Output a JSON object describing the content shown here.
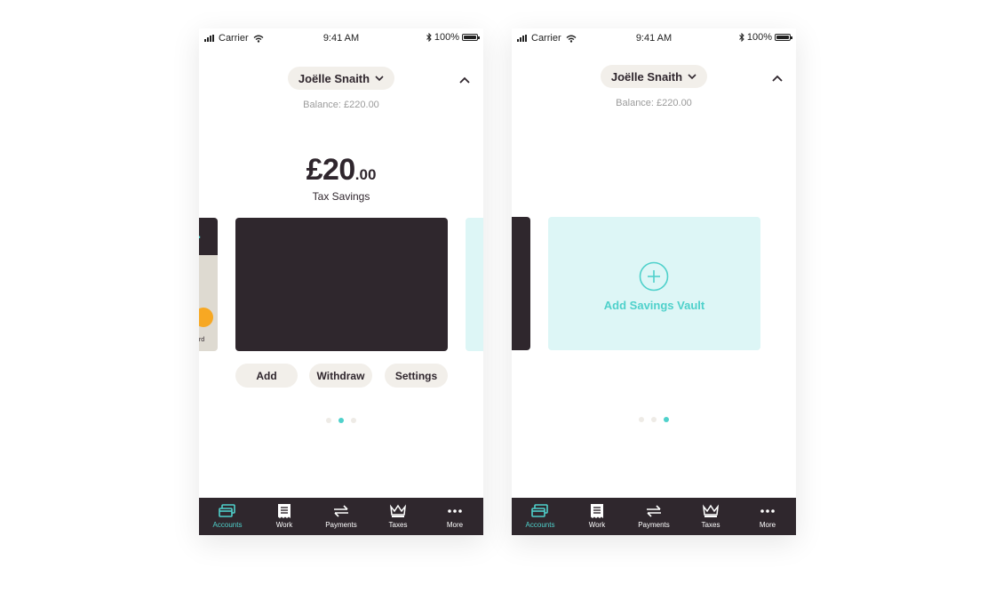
{
  "status": {
    "carrier": "Carrier",
    "time": "9:41 AM",
    "battery": "100%"
  },
  "user": {
    "name": "Joëlle Snaith",
    "balance": "Balance: £220.00"
  },
  "savings": {
    "amount_main": "£20",
    "amount_decimal": ".00",
    "label": "Tax Savings"
  },
  "actions": {
    "add": "Add",
    "withdraw": "Withdraw",
    "settings": "Settings"
  },
  "vault": {
    "add_label": "Add Savings Vault"
  },
  "card_peek": {
    "logo_text": "t",
    "logo_dot": ".",
    "mastercard_fragment": "ard"
  },
  "pagination": {
    "screen1_active": 2,
    "screen2_active": 3,
    "total": 3
  },
  "nav": {
    "items": [
      {
        "label": "Accounts",
        "icon": "cards-icon",
        "active": true
      },
      {
        "label": "Work",
        "icon": "document-icon",
        "active": false
      },
      {
        "label": "Payments",
        "icon": "arrows-icon",
        "active": false
      },
      {
        "label": "Taxes",
        "icon": "crown-icon",
        "active": false
      },
      {
        "label": "More",
        "icon": "more-icon",
        "active": false
      }
    ]
  },
  "colors": {
    "accent": "#4fd1cb",
    "dark": "#2f272d",
    "pill": "#f2efea",
    "vault": "#ddf6f6"
  }
}
